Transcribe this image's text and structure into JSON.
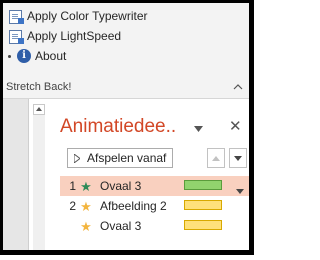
{
  "ribbon": {
    "items": [
      {
        "label": "Apply Color Typewriter",
        "icon": "add-in-doc-icon"
      },
      {
        "label": "Apply LightSpeed",
        "icon": "add-in-doc-icon"
      },
      {
        "label": "About",
        "icon": "info-icon"
      }
    ],
    "group_label": "Stretch Back!"
  },
  "pane": {
    "title": "Animatiedee..",
    "close_glyph": "✕",
    "play_label": "Afspelen vanaf",
    "animations": [
      {
        "number": "1",
        "name": "Ovaal 3",
        "selected": true,
        "star_color": "#2e8b57",
        "bar_fill": "#92d36e",
        "bar_border": "#5b9c3c"
      },
      {
        "number": "2",
        "name": "Afbeelding 2",
        "selected": false,
        "star_color": "#f3b53f",
        "bar_fill": "#ffe17a",
        "bar_border": "#d8a900"
      },
      {
        "number": "",
        "name": "Ovaal 3",
        "selected": false,
        "star_color": "#f3b53f",
        "bar_fill": "#ffe17a",
        "bar_border": "#d8a900"
      }
    ]
  },
  "colors": {
    "accent": "#d24726",
    "selected_row": "#f9d0bf",
    "ribbon_bg": "#f3f3f3"
  }
}
